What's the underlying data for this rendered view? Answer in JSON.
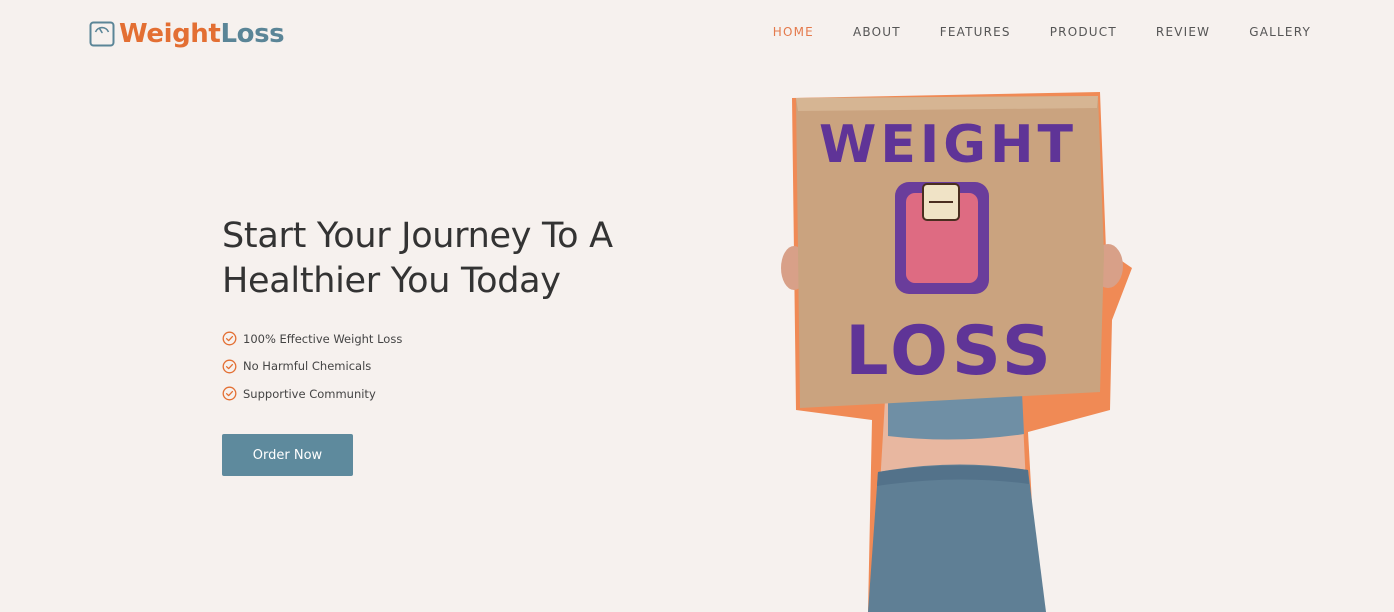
{
  "brand": {
    "name_part1": "Weight",
    "name_part2": "Loss",
    "icon": "scale-icon"
  },
  "nav": [
    {
      "label": "HOME",
      "active": true
    },
    {
      "label": "ABOUT",
      "active": false
    },
    {
      "label": "FEATURES",
      "active": false
    },
    {
      "label": "PRODUCT",
      "active": false
    },
    {
      "label": "REVIEW",
      "active": false
    },
    {
      "label": "GALLERY",
      "active": false
    }
  ],
  "hero": {
    "title_line1": "Start Your Journey To A",
    "title_line2": "Healthier You Today",
    "features": [
      {
        "text": "100% Effective Weight Loss",
        "icon": "check-circle-icon"
      },
      {
        "text": "No Harmful Chemicals",
        "icon": "check-circle-icon"
      },
      {
        "text": "Supportive Community",
        "icon": "check-circle-icon"
      }
    ],
    "cta_label": "Order Now",
    "sign_line1": "WEIGHT",
    "sign_line2": "LOSS"
  },
  "colors": {
    "accent": "#e36f33",
    "brand_blue": "#5a8597",
    "button": "#5e8a9d",
    "background": "#f6f1ee"
  }
}
